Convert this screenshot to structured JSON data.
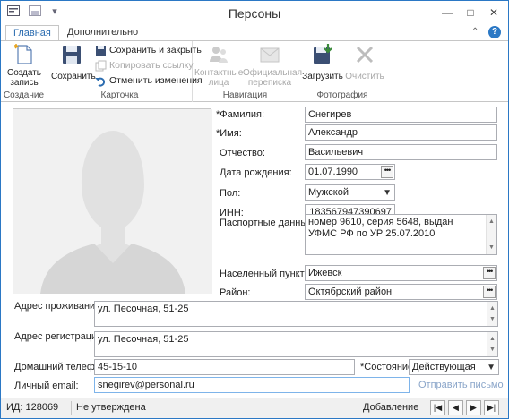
{
  "window": {
    "title": "Персоны",
    "minimize": "—",
    "maximize": "□",
    "close": "✕",
    "help": "?"
  },
  "tabs": [
    {
      "label": "Главная",
      "active": true
    },
    {
      "label": "Дополнительно",
      "active": false
    }
  ],
  "ribbon": {
    "groups": {
      "create": "Создание",
      "card": "Карточка",
      "navigation": "Навигация",
      "photo": "Фотография"
    },
    "create_record": [
      "Создать",
      "запись"
    ],
    "save": "Сохранить",
    "save_close": "Сохранить и закрыть",
    "copy_link": "Копировать ссылку",
    "cancel_changes": "Отменить изменения",
    "contact_persons": [
      "Контактные",
      "лица"
    ],
    "official_correspondence": [
      "Официальная",
      "переписка"
    ],
    "load": "Загрузить",
    "clear": "Очистить"
  },
  "form": {
    "surname_label": "*Фамилия:",
    "surname": "Снегирев",
    "name_label": "*Имя:",
    "name": "Александр",
    "patronymic_label": "Отчество:",
    "patronymic": "Васильевич",
    "birthdate_label": "Дата рождения:",
    "birthdate": "01.07.1990",
    "gender_label": "Пол:",
    "gender": "Мужской",
    "inn_label": "ИНН:",
    "inn": "183567947390697",
    "passport_label": "Паспортные данные:",
    "passport": "номер 9610, серия 5648, выдан УФМС РФ по УР 25.07.2010",
    "city_label": "Населенный пункт:",
    "city": "Ижевск",
    "district_label": "Район:",
    "district": "Октябрский район",
    "residence_label": "Адрес проживания:",
    "residence": "ул. Песочная, 51-25",
    "registration_label": "Адрес регистрации:",
    "registration": "ул. Песочная, 51-25",
    "home_phone_label": "Домашний телефон:",
    "home_phone": "45-15-10",
    "state_label": "*Состояние:",
    "state": "Действующая",
    "email_label": "Личный email:",
    "email": "snegirev@personal.ru",
    "send_letter": "Отправить письмо",
    "dots": "•••"
  },
  "status": {
    "id": "ИД: 128069",
    "approval": "Не утверждена",
    "mode": "Добавление",
    "nav": [
      "|◀",
      "◀",
      "▶",
      "▶|"
    ]
  },
  "colors": {
    "accent": "#2b6cb0",
    "border": "#abadb3",
    "save_green": "#3a8a3a",
    "link_disabled": "#8aa5c9"
  }
}
